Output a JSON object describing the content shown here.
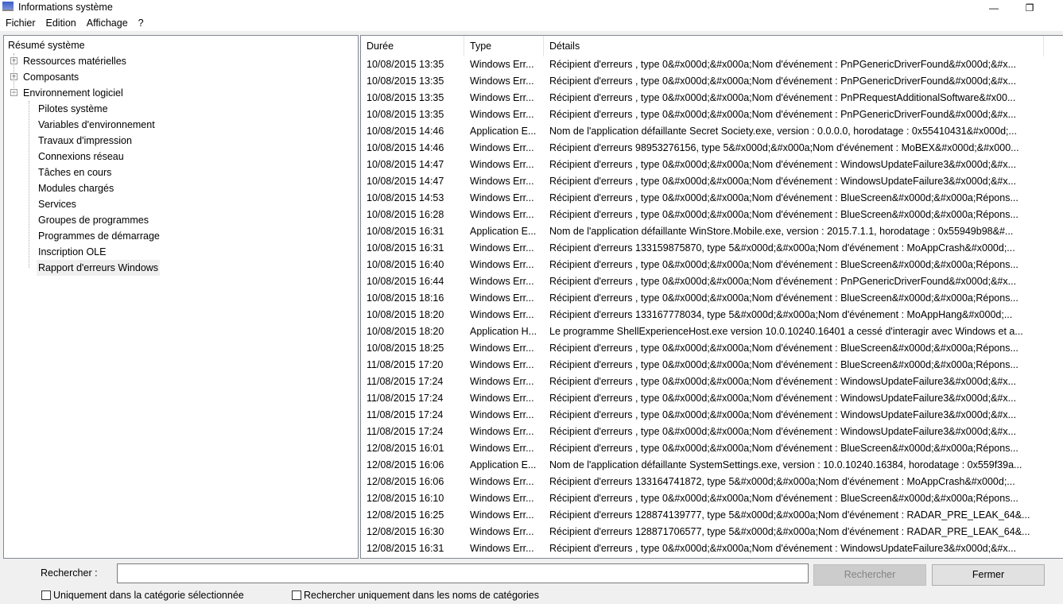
{
  "window": {
    "title": "Informations système",
    "minimize": "—",
    "restore": "❐"
  },
  "menu": [
    "Fichier",
    "Edition",
    "Affichage",
    "?"
  ],
  "tree": {
    "root": "Résumé système",
    "nodes": [
      {
        "label": "Ressources matérielles",
        "expander": "+"
      },
      {
        "label": "Composants",
        "expander": "+"
      },
      {
        "label": "Environnement logiciel",
        "expander": "−"
      }
    ],
    "children": [
      "Pilotes système",
      "Variables d'environnement",
      "Travaux d'impression",
      "Connexions réseau",
      "Tâches en cours",
      "Modules chargés",
      "Services",
      "Groupes de programmes",
      "Programmes de démarrage",
      "Inscription OLE",
      "Rapport d'erreurs Windows"
    ],
    "selected": "Rapport d'erreurs Windows"
  },
  "table": {
    "headers": [
      "Durée",
      "Type",
      "Détails"
    ],
    "rows": [
      [
        "10/08/2015 13:35",
        "Windows Err...",
        "Récipient d'erreurs , type 0&#x000d;&#x000a;Nom d'événement : PnPGenericDriverFound&#x000d;&#x..."
      ],
      [
        "10/08/2015 13:35",
        "Windows Err...",
        "Récipient d'erreurs , type 0&#x000d;&#x000a;Nom d'événement : PnPGenericDriverFound&#x000d;&#x..."
      ],
      [
        "10/08/2015 13:35",
        "Windows Err...",
        "Récipient d'erreurs , type 0&#x000d;&#x000a;Nom d'événement : PnPRequestAdditionalSoftware&#x00..."
      ],
      [
        "10/08/2015 13:35",
        "Windows Err...",
        "Récipient d'erreurs , type 0&#x000d;&#x000a;Nom d'événement : PnPGenericDriverFound&#x000d;&#x..."
      ],
      [
        "10/08/2015 14:46",
        "Application E...",
        "Nom de l'application défaillante Secret Society.exe, version : 0.0.0.0, horodatage : 0x55410431&#x000d;..."
      ],
      [
        "10/08/2015 14:46",
        "Windows Err...",
        "Récipient d'erreurs 98953276156, type 5&#x000d;&#x000a;Nom d'événement : MoBEX&#x000d;&#x000..."
      ],
      [
        "10/08/2015 14:47",
        "Windows Err...",
        "Récipient d'erreurs , type 0&#x000d;&#x000a;Nom d'événement : WindowsUpdateFailure3&#x000d;&#x..."
      ],
      [
        "10/08/2015 14:47",
        "Windows Err...",
        "Récipient d'erreurs , type 0&#x000d;&#x000a;Nom d'événement : WindowsUpdateFailure3&#x000d;&#x..."
      ],
      [
        "10/08/2015 14:53",
        "Windows Err...",
        "Récipient d'erreurs , type 0&#x000d;&#x000a;Nom d'événement : BlueScreen&#x000d;&#x000a;Répons..."
      ],
      [
        "10/08/2015 16:28",
        "Windows Err...",
        "Récipient d'erreurs , type 0&#x000d;&#x000a;Nom d'événement : BlueScreen&#x000d;&#x000a;Répons..."
      ],
      [
        "10/08/2015 16:31",
        "Application E...",
        "Nom de l'application défaillante WinStore.Mobile.exe, version : 2015.7.1.1, horodatage : 0x55949b98&#..."
      ],
      [
        "10/08/2015 16:31",
        "Windows Err...",
        "Récipient d'erreurs 133159875870, type 5&#x000d;&#x000a;Nom d'événement : MoAppCrash&#x000d;..."
      ],
      [
        "10/08/2015 16:40",
        "Windows Err...",
        "Récipient d'erreurs , type 0&#x000d;&#x000a;Nom d'événement : BlueScreen&#x000d;&#x000a;Répons..."
      ],
      [
        "10/08/2015 16:44",
        "Windows Err...",
        "Récipient d'erreurs , type 0&#x000d;&#x000a;Nom d'événement : PnPGenericDriverFound&#x000d;&#x..."
      ],
      [
        "10/08/2015 18:16",
        "Windows Err...",
        "Récipient d'erreurs , type 0&#x000d;&#x000a;Nom d'événement : BlueScreen&#x000d;&#x000a;Répons..."
      ],
      [
        "10/08/2015 18:20",
        "Windows Err...",
        "Récipient d'erreurs 133167778034, type 5&#x000d;&#x000a;Nom d'événement : MoAppHang&#x000d;..."
      ],
      [
        "10/08/2015 18:20",
        "Application H...",
        "Le programme ShellExperienceHost.exe version 10.0.10240.16401 a cessé d'interagir avec Windows et a..."
      ],
      [
        "10/08/2015 18:25",
        "Windows Err...",
        "Récipient d'erreurs , type 0&#x000d;&#x000a;Nom d'événement : BlueScreen&#x000d;&#x000a;Répons..."
      ],
      [
        "11/08/2015 17:20",
        "Windows Err...",
        "Récipient d'erreurs , type 0&#x000d;&#x000a;Nom d'événement : BlueScreen&#x000d;&#x000a;Répons..."
      ],
      [
        "11/08/2015 17:24",
        "Windows Err...",
        "Récipient d'erreurs , type 0&#x000d;&#x000a;Nom d'événement : WindowsUpdateFailure3&#x000d;&#x..."
      ],
      [
        "11/08/2015 17:24",
        "Windows Err...",
        "Récipient d'erreurs , type 0&#x000d;&#x000a;Nom d'événement : WindowsUpdateFailure3&#x000d;&#x..."
      ],
      [
        "11/08/2015 17:24",
        "Windows Err...",
        "Récipient d'erreurs , type 0&#x000d;&#x000a;Nom d'événement : WindowsUpdateFailure3&#x000d;&#x..."
      ],
      [
        "11/08/2015 17:24",
        "Windows Err...",
        "Récipient d'erreurs , type 0&#x000d;&#x000a;Nom d'événement : WindowsUpdateFailure3&#x000d;&#x..."
      ],
      [
        "12/08/2015 16:01",
        "Windows Err...",
        "Récipient d'erreurs , type 0&#x000d;&#x000a;Nom d'événement : BlueScreen&#x000d;&#x000a;Répons..."
      ],
      [
        "12/08/2015 16:06",
        "Application E...",
        "Nom de l'application défaillante SystemSettings.exe, version : 10.0.10240.16384, horodatage : 0x559f39a..."
      ],
      [
        "12/08/2015 16:06",
        "Windows Err...",
        "Récipient d'erreurs 133164741872, type 5&#x000d;&#x000a;Nom d'événement : MoAppCrash&#x000d;..."
      ],
      [
        "12/08/2015 16:10",
        "Windows Err...",
        "Récipient d'erreurs , type 0&#x000d;&#x000a;Nom d'événement : BlueScreen&#x000d;&#x000a;Répons..."
      ],
      [
        "12/08/2015 16:25",
        "Windows Err...",
        "Récipient d'erreurs 128874139777, type 5&#x000d;&#x000a;Nom d'événement : RADAR_PRE_LEAK_64&..."
      ],
      [
        "12/08/2015 16:30",
        "Windows Err...",
        "Récipient d'erreurs 128871706577, type 5&#x000d;&#x000a;Nom d'événement : RADAR_PRE_LEAK_64&..."
      ],
      [
        "12/08/2015 16:31",
        "Windows Err...",
        "Récipient d'erreurs , type 0&#x000d;&#x000a;Nom d'événement : WindowsUpdateFailure3&#x000d;&#x..."
      ]
    ]
  },
  "search": {
    "label": "Rechercher :",
    "value": "",
    "search_button": "Rechercher",
    "close_button": "Fermer",
    "check_category": "Uniquement dans la catégorie sélectionnée",
    "check_names": "Rechercher uniquement dans les noms de catégories"
  }
}
